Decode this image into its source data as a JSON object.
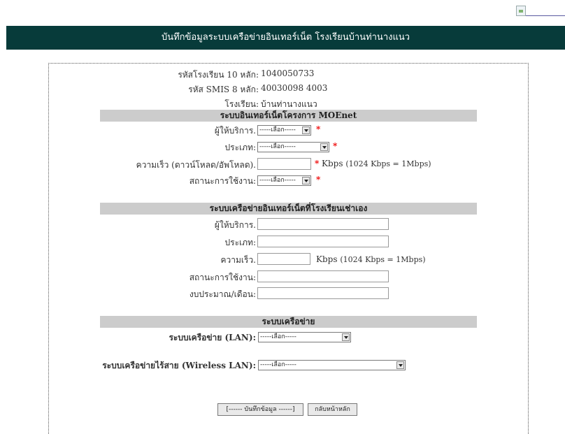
{
  "header": {
    "title": "บันทึกข้อมูลระบบเครือข่ายอินเทอร์เน็ต โรงเรียนบ้านท่านางแนว"
  },
  "school": {
    "code10_label": "รหัสโรงเรียน 10 หลัก:",
    "code10_value": "1040050733",
    "smis_label": "รหัส SMIS 8 หลัก:",
    "smis_value": "40030098 4003",
    "name_label": "โรงเรียน:",
    "name_value": "บ้านท่านางแนว"
  },
  "moenet": {
    "title": "ระบบอินเทอร์เน็ตโครงการ MOEnet",
    "provider_label": "ผู้ให้บริการ.",
    "provider_value": "-----เลือก-----",
    "type_label": "ประเภท:",
    "type_value": "-----เลือก-----",
    "speed_label": "ความเร็ว (ดาวน์โหลด/อัพโหลด).",
    "speed_value": "",
    "speed_unit": "Kbps",
    "speed_note": "(1024 Kbps = 1Mbps)",
    "status_label": "สถานะการใช้งาน:",
    "status_value": "-----เลือก-----",
    "required_mark": "*"
  },
  "own": {
    "title": "ระบบเครือข่ายอินเทอร์เน็ตที่โรงเรียนเช่าเอง",
    "provider_label": "ผู้ให้บริการ.",
    "provider_value": "",
    "type_label": "ประเภท:",
    "type_value": "",
    "speed_label": "ความเร็ว.",
    "speed_value": "",
    "speed_unit": "Kbps",
    "speed_note": "(1024 Kbps = 1Mbps)",
    "status_label": "สถานะการใช้งาน:",
    "status_value": "",
    "budget_label": "งบประมาณ/เดือน:",
    "budget_value": ""
  },
  "network": {
    "title": "ระบบเครือข่าย",
    "lan_label": "ระบบเครือข่าย (LAN):",
    "lan_value": "-----เลือก-----",
    "wlan_label": "ระบบเครือข่ายไร้สาย (Wireless LAN):",
    "wlan_value": "-----เลือก-----"
  },
  "actions": {
    "save_label": "[------ บันทึกข้อมูล ------]",
    "home_label": "กลับหน้าหลัก"
  }
}
